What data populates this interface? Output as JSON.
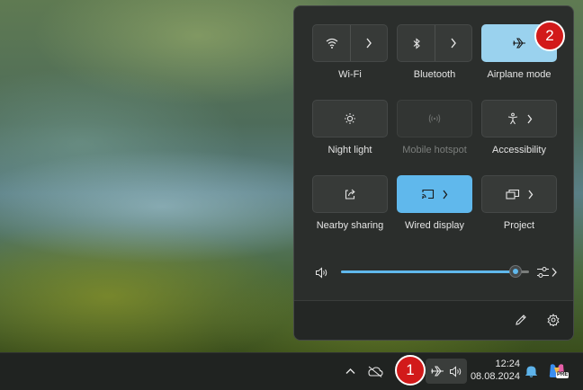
{
  "quick_settings": {
    "tiles": [
      {
        "id": "wifi",
        "label": "Wi-Fi",
        "icon": "wifi-icon",
        "state": "off",
        "split": true
      },
      {
        "id": "bluetooth",
        "label": "Bluetooth",
        "icon": "bluetooth-icon",
        "state": "off",
        "split": true
      },
      {
        "id": "airplane",
        "label": "Airplane mode",
        "icon": "airplane-icon",
        "state": "on",
        "split": false
      },
      {
        "id": "night-light",
        "label": "Night light",
        "icon": "brightness-icon",
        "state": "off",
        "split": false
      },
      {
        "id": "mobile-hotspot",
        "label": "Mobile hotspot",
        "icon": "hotspot-icon",
        "state": "disabled",
        "split": false
      },
      {
        "id": "accessibility",
        "label": "Accessibility",
        "icon": "accessibility-icon",
        "state": "off",
        "split": false,
        "has_chevron": true
      },
      {
        "id": "nearby-sharing",
        "label": "Nearby sharing",
        "icon": "share-icon",
        "state": "off",
        "split": false
      },
      {
        "id": "wired-display",
        "label": "Wired display",
        "icon": "cast-icon",
        "state": "on",
        "split": false,
        "has_chevron": true
      },
      {
        "id": "project",
        "label": "Project",
        "icon": "project-icon",
        "state": "off",
        "split": false,
        "has_chevron": true
      }
    ],
    "volume": {
      "level_percent": 93,
      "icon": "speaker-icon",
      "output_icon": "audio-output-icon"
    },
    "footer": {
      "edit_icon": "pencil-icon",
      "settings_icon": "gear-icon"
    }
  },
  "callouts": {
    "one": "1",
    "two": "2"
  },
  "taskbar": {
    "time": "12:24",
    "date": "08.08.2024",
    "tray_icons": [
      "chevron-up-icon",
      "onedrive-icon",
      "airplane-icon",
      "speaker-icon",
      "bell-icon",
      "copilot-icon"
    ],
    "copilot_badge": "PRE"
  },
  "colors": {
    "accent": "#60b8ec",
    "airplane_on": "#9ad2ee",
    "callout": "#d21a1a"
  }
}
